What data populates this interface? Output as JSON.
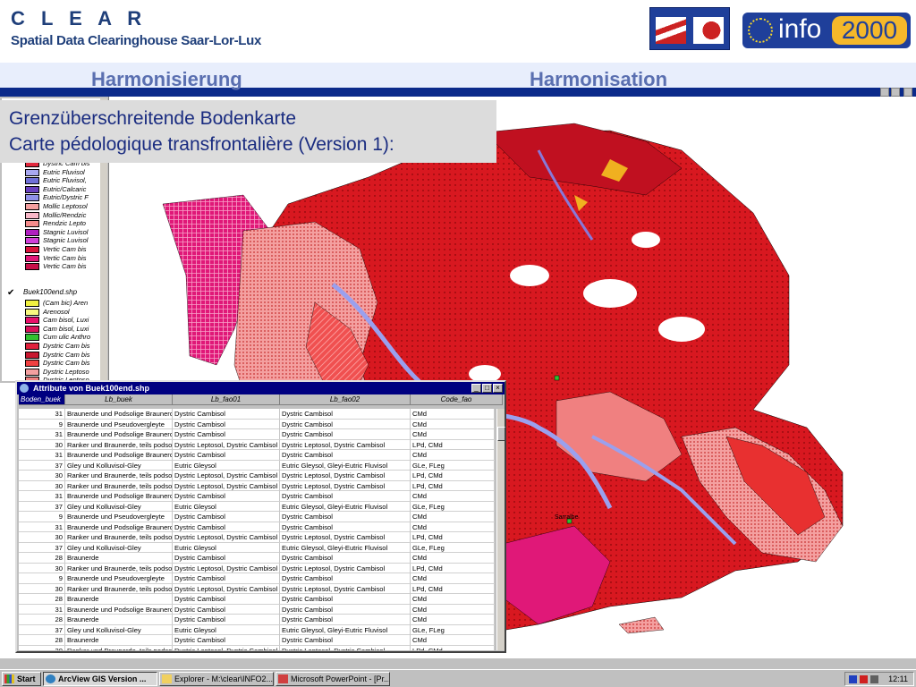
{
  "header": {
    "title": "C L E A R",
    "subtitle": "Spatial Data Clearinghouse Saar-Lor-Lux",
    "logo_info": "info",
    "logo_year": "2000"
  },
  "band": {
    "left": "Harmonisierung",
    "right": "Harmonisation"
  },
  "caption": {
    "line1": "Grenzüberschreitende Bodenkarte",
    "line2": "Carte pédologique transfrontalière (Version 1):"
  },
  "legend": {
    "theme_name": "Buek100end.shp",
    "items_top": [
      {
        "label": "Dystric Cam bis",
        "color": "#e0283c"
      },
      {
        "label": "Eutric Fluvisol",
        "color": "#a8a8f0"
      },
      {
        "label": "Eutric Fluvisol,",
        "color": "#7070d8"
      },
      {
        "label": "Eutric/Calcaric",
        "color": "#6a40c0"
      },
      {
        "label": "Eutric/Dystric F",
        "color": "#9090e8"
      },
      {
        "label": "Mollic Leptosol",
        "color": "#f4a0a0"
      },
      {
        "label": "Mollic/Rendzic",
        "color": "#f8b8c8"
      },
      {
        "label": "Rendzic Lepto",
        "color": "#f48c8c"
      },
      {
        "label": "Stagnic Luvisol",
        "color": "#b020c0"
      },
      {
        "label": "Stagnic Luvisol",
        "color": "#d040d8"
      },
      {
        "label": "Vertic Cam bis",
        "color": "#d8143c"
      },
      {
        "label": "Vertic Cam bis",
        "color": "#e01878"
      },
      {
        "label": "Vertic Cam bis",
        "color": "#c8104a"
      }
    ],
    "items_bottom": [
      {
        "label": "(Cam bic) Aren",
        "color": "#f0f040"
      },
      {
        "label": "Arenosol",
        "color": "#f8f880"
      },
      {
        "label": "Cam bisol, Luxi",
        "color": "#e8106a"
      },
      {
        "label": "Cam bisol, Luxi",
        "color": "#d8105a"
      },
      {
        "label": "Cum ulic Anthro",
        "color": "#30c030"
      },
      {
        "label": "Dystric Cam bis",
        "color": "#e0203c"
      },
      {
        "label": "Dystric Cam bis",
        "color": "#c81830"
      },
      {
        "label": "Dystric Cam bis",
        "color": "#f04040"
      },
      {
        "label": "Dystric Leptoso",
        "color": "#f4a0a0"
      },
      {
        "label": "Dystric Leptoso",
        "color": "#f08080"
      }
    ]
  },
  "attribute_table": {
    "title": "Attribute von Buek100end.shp",
    "columns": [
      "Boden_buek",
      "Lb_buek",
      "Lb_fao01",
      "Lb_fao02",
      "Code_fao"
    ],
    "rows": [
      [
        "31",
        "Braunerde und Podsolige Braunerde",
        "Dystric Cambisol",
        "Dystric Cambisol",
        "CMd"
      ],
      [
        "9",
        "Braunerde und Pseudovergleyte",
        "Dystric Cambisol",
        "Dystric Cambisol",
        "CMd"
      ],
      [
        "31",
        "Braunerde und Podsolige Braunerde",
        "Dystric Cambisol",
        "Dystric Cambisol",
        "CMd"
      ],
      [
        "30",
        "Ranker und Braunerde, teils podsolig",
        "Dystric Leptosol, Dystric Cambisol",
        "Dystric Leptosol, Dystric Cambisol",
        "LPd, CMd"
      ],
      [
        "31",
        "Braunerde und Podsolige Braunerde",
        "Dystric Cambisol",
        "Dystric Cambisol",
        "CMd"
      ],
      [
        "37",
        "Gley und Kolluvisol-Gley",
        "Eutric Gleysol",
        "Eutric Gleysol, Gleyi-Eutric Fluvisol",
        "GLe, FLeg"
      ],
      [
        "30",
        "Ranker und Braunerde, teils podsolig",
        "Dystric Leptosol, Dystric Cambisol",
        "Dystric Leptosol, Dystric Cambisol",
        "LPd, CMd"
      ],
      [
        "30",
        "Ranker und Braunerde, teils podsolig",
        "Dystric Leptosol, Dystric Cambisol",
        "Dystric Leptosol, Dystric Cambisol",
        "LPd, CMd"
      ],
      [
        "31",
        "Braunerde und Podsolige Braunerde",
        "Dystric Cambisol",
        "Dystric Cambisol",
        "CMd"
      ],
      [
        "37",
        "Gley und Kolluvisol-Gley",
        "Eutric Gleysol",
        "Eutric Gleysol, Gleyi-Eutric Fluvisol",
        "GLe, FLeg"
      ],
      [
        "9",
        "Braunerde und Pseudovergleyte",
        "Dystric Cambisol",
        "Dystric Cambisol",
        "CMd"
      ],
      [
        "31",
        "Braunerde und Podsolige Braunerde",
        "Dystric Cambisol",
        "Dystric Cambisol",
        "CMd"
      ],
      [
        "30",
        "Ranker und Braunerde, teils podsolig",
        "Dystric Leptosol, Dystric Cambisol",
        "Dystric Leptosol, Dystric Cambisol",
        "LPd, CMd"
      ],
      [
        "37",
        "Gley und Kolluvisol-Gley",
        "Eutric Gleysol",
        "Eutric Gleysol, Gleyi-Eutric Fluvisol",
        "GLe, FLeg"
      ],
      [
        "28",
        "Braunerde",
        "Dystric Cambisol",
        "Dystric Cambisol",
        "CMd"
      ],
      [
        "30",
        "Ranker und Braunerde, teils podsolig",
        "Dystric Leptosol, Dystric Cambisol",
        "Dystric Leptosol, Dystric Cambisol",
        "LPd, CMd"
      ],
      [
        "9",
        "Braunerde und Pseudovergleyte",
        "Dystric Cambisol",
        "Dystric Cambisol",
        "CMd"
      ],
      [
        "30",
        "Ranker und Braunerde, teils podsolig",
        "Dystric Leptosol, Dystric Cambisol",
        "Dystric Leptosol, Dystric Cambisol",
        "LPd, CMd"
      ],
      [
        "28",
        "Braunerde",
        "Dystric Cambisol",
        "Dystric Cambisol",
        "CMd"
      ],
      [
        "31",
        "Braunerde und Podsolige Braunerde",
        "Dystric Cambisol",
        "Dystric Cambisol",
        "CMd"
      ],
      [
        "28",
        "Braunerde",
        "Dystric Cambisol",
        "Dystric Cambisol",
        "CMd"
      ],
      [
        "37",
        "Gley und Kolluvisol-Gley",
        "Eutric Gleysol",
        "Eutric Gleysol, Gleyi-Eutric Fluvisol",
        "GLe, FLeg"
      ],
      [
        "28",
        "Braunerde",
        "Dystric Cambisol",
        "Dystric Cambisol",
        "CMd"
      ],
      [
        "30",
        "Ranker und Braunerde, teils podsolig",
        "Dystric Leptosol, Dystric Cambisol",
        "Dystric Leptosol, Dystric Cambisol",
        "LPd, CMd"
      ]
    ]
  },
  "map": {
    "city_label": "Sarralbe"
  },
  "taskbar": {
    "start": "Start",
    "tasks": [
      "ArcView GIS Version ...",
      "Explorer - M:\\clear\\INFO2...",
      "Microsoft PowerPoint - [Pr..."
    ],
    "clock": "12:11"
  },
  "colors": {
    "title_blue": "#1f3f7a",
    "band_text": "#5a6fb0",
    "caption_text": "#1a2c80",
    "titlebar": "#000080"
  }
}
